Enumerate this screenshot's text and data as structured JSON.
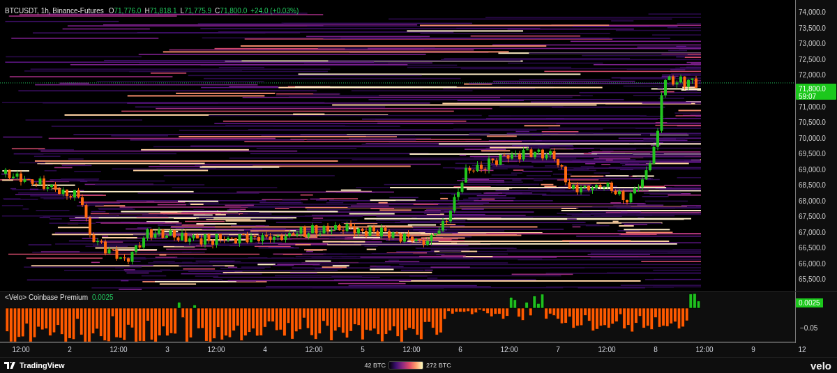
{
  "legend": {
    "symbol": "BTCUSDT, 1h, Binance-Futures",
    "ohlc": [
      {
        "label": "O",
        "value": "71,776.0"
      },
      {
        "label": "H",
        "value": "71,818.1"
      },
      {
        "label": "L",
        "value": "71,775.9"
      },
      {
        "label": "C",
        "value": "71,800.0"
      }
    ],
    "change": "+24.0 (+0.03%)"
  },
  "price_axis": [
    "74,000.0",
    "73,500.0",
    "73,000.0",
    "72,500.0",
    "72,000.0",
    "71,000.0",
    "70,500.0",
    "70,000.0",
    "69,500.0",
    "69,000.0",
    "68,500.0",
    "68,000.0",
    "67,500.0",
    "67,000.0",
    "66,500.0",
    "66,000.0",
    "65,500.0"
  ],
  "price_tag": {
    "price": "71,800.0",
    "countdown": "59:07"
  },
  "indicator": {
    "name": "<Velo> Coinbase Premium",
    "value": "0.0025",
    "axis_tag": "0.0025",
    "axis_label": "−0.05"
  },
  "time_axis": [
    "12:00",
    "2",
    "12:00",
    "3",
    "12:00",
    "4",
    "12:00",
    "5",
    "12:00",
    "6",
    "12:00",
    "7",
    "12:00",
    "8",
    "12:00",
    "9",
    "12"
  ],
  "footer": {
    "brand": "TradingView",
    "scale_min": "42 BTC",
    "scale_max": "272 BTC",
    "logo": "velo"
  }
}
